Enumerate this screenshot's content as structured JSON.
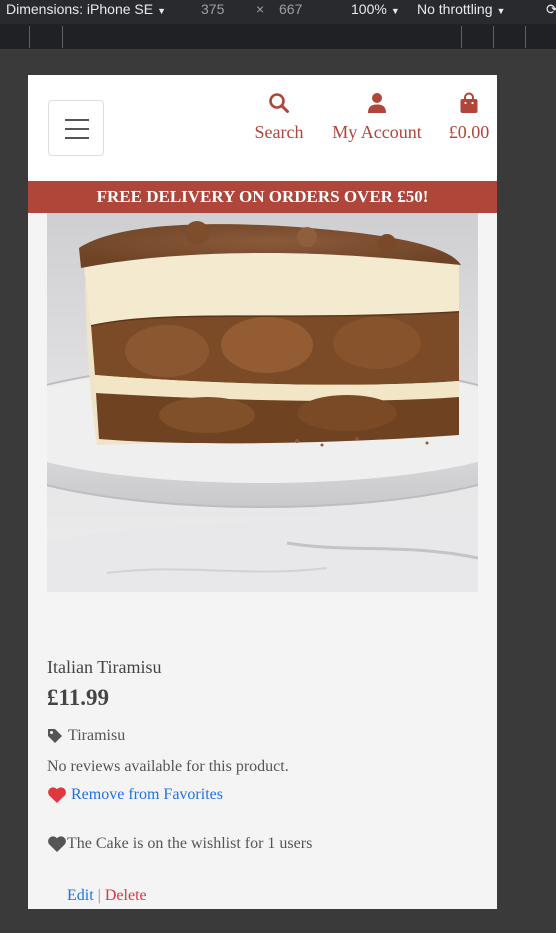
{
  "devtools": {
    "device_label": "Dimensions: iPhone SE",
    "width": "375",
    "times": "×",
    "height": "667",
    "zoom": "100%",
    "throttling": "No throttling"
  },
  "header": {
    "nav": [
      {
        "label": "Search",
        "icon": "search-icon"
      },
      {
        "label": "My Account",
        "icon": "user-icon"
      },
      {
        "label": "£0.00",
        "icon": "shopping-bag-icon"
      }
    ]
  },
  "promo": {
    "text": "FREE DELIVERY ON ORDERS OVER £50!"
  },
  "product": {
    "name": "Italian Tiramisu",
    "price": "£11.99",
    "category": "Tiramisu",
    "reviews_text": "No reviews available for this product.",
    "favorite_label": "Remove from Favorites",
    "wishlist_text": "The Cake is on the wishlist for 1 users",
    "edit_label": "Edit",
    "separator": "|",
    "delete_label": "Delete"
  },
  "colors": {
    "brand": "#b0453a",
    "link": "#1a73e8",
    "danger": "#dc3545",
    "heart": "#e0383e"
  }
}
